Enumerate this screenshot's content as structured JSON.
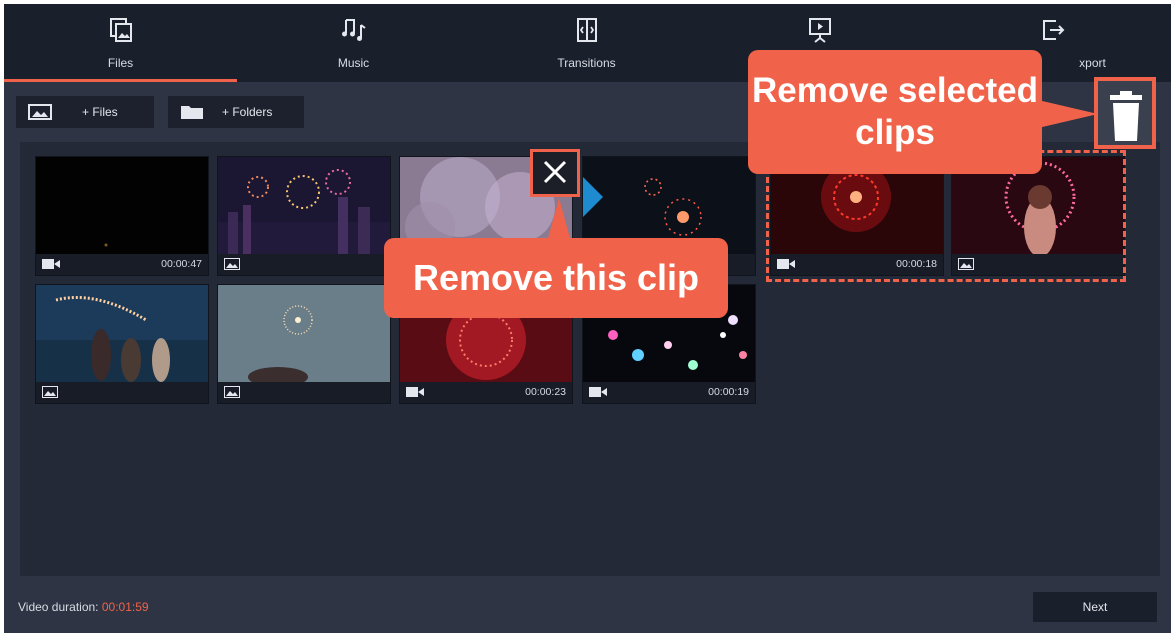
{
  "nav": {
    "tabs": [
      {
        "label": "Files",
        "icon": "files-icon"
      },
      {
        "label": "Music",
        "icon": "music-icon"
      },
      {
        "label": "Transitions",
        "icon": "transitions-icon"
      },
      {
        "label": "",
        "icon": "slideshow-icon"
      },
      {
        "label": "xport",
        "icon": "export-icon"
      }
    ],
    "active_index": 0
  },
  "toolbar": {
    "add_files_label": "+ Files",
    "add_folders_label": "+ Folders"
  },
  "clips": [
    {
      "kind": "video",
      "duration": "00:00:47"
    },
    {
      "kind": "image",
      "duration": ""
    },
    {
      "kind": "image",
      "duration": ""
    },
    {
      "kind": "image",
      "duration": ""
    },
    {
      "kind": "video",
      "duration": "00:00:18"
    },
    {
      "kind": "image",
      "duration": ""
    },
    {
      "kind": "image",
      "duration": ""
    },
    {
      "kind": "image",
      "duration": ""
    },
    {
      "kind": "video",
      "duration": "00:00:23"
    },
    {
      "kind": "video",
      "duration": "00:00:19"
    }
  ],
  "callouts": {
    "remove_selected": "Remove selected clips",
    "remove_this": "Remove this clip"
  },
  "footer": {
    "duration_label": "Video duration:",
    "duration_value": "00:01:59",
    "next_label": "Next"
  },
  "colors": {
    "accent": "#f0634a",
    "nav_bg": "#1a1f2c",
    "panel_bg": "#2e3443",
    "media_bg": "#232937"
  }
}
